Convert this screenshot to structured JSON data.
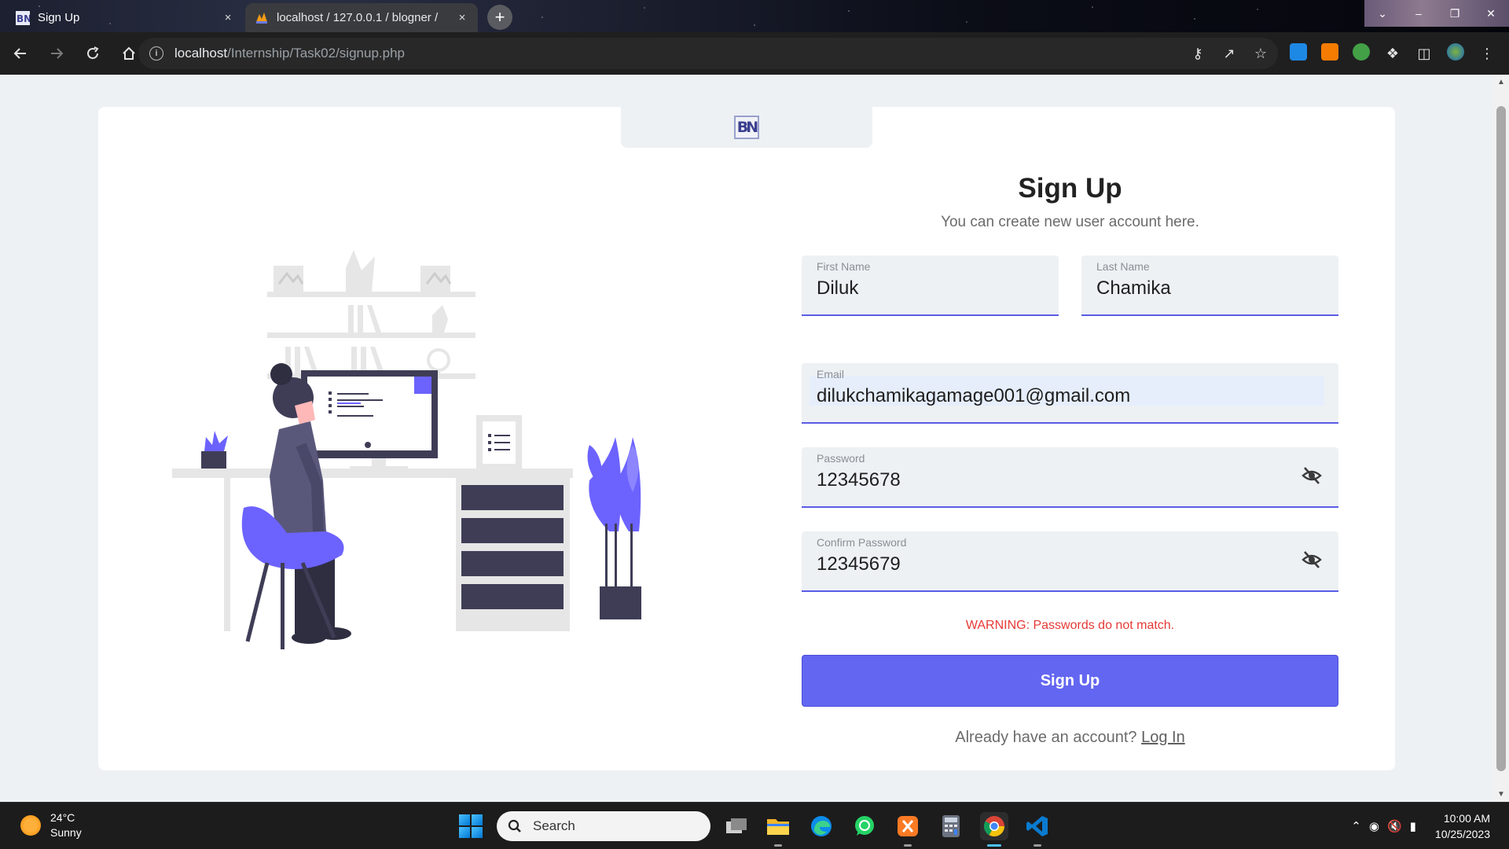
{
  "browser": {
    "tabs": [
      {
        "title": "Sign Up",
        "active": true,
        "favicon": "bn-logo-icon"
      },
      {
        "title": "localhost / 127.0.0.1 / blogner /",
        "active": false,
        "favicon": "phpmyadmin-icon"
      }
    ],
    "url_host": "localhost",
    "url_path": "/Internship/Task02/signup.php",
    "close_symbol": "×",
    "new_tab_symbol": "+"
  },
  "page": {
    "logo_text": "BN",
    "title": "Sign Up",
    "subtitle": "You can create new user account here.",
    "fields": {
      "first_name": {
        "label": "First Name",
        "value": "Diluk"
      },
      "last_name": {
        "label": "Last Name",
        "value": "Chamika"
      },
      "email": {
        "label": "Email",
        "value": "dilukchamikagamage001@gmail.com"
      },
      "password": {
        "label": "Password",
        "value": "12345678"
      },
      "confirm_password": {
        "label": "Confirm Password",
        "value": "12345679"
      }
    },
    "warning": "WARNING: Passwords do not match.",
    "signup_button": "Sign Up",
    "already_text": "Already have an account?",
    "login_link": "Log In",
    "accent_color": "#6366f1",
    "warning_color": "#e53935"
  },
  "taskbar": {
    "weather_temp": "24°C",
    "weather_desc": "Sunny",
    "search_placeholder": "Search",
    "time": "10:00 AM",
    "date": "10/25/2023",
    "apps": [
      "task-view-icon",
      "file-explorer-icon",
      "edge-icon",
      "whatsapp-icon",
      "xampp-icon",
      "calculator-icon",
      "chrome-icon",
      "vscode-icon"
    ]
  }
}
